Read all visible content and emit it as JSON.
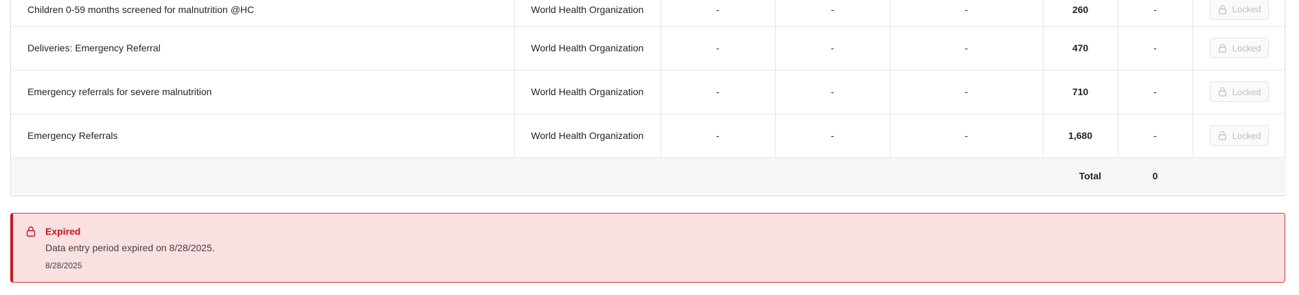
{
  "table": {
    "rows": [
      {
        "name": "Children 0-59 months screened for malnutrition @HC",
        "organization": "World Health Organization",
        "v1": "-",
        "v2": "-",
        "v3": "-",
        "v4": "260",
        "v5": "-",
        "action": "Locked"
      },
      {
        "name": "Deliveries: Emergency Referral",
        "organization": "World Health Organization",
        "v1": "-",
        "v2": "-",
        "v3": "-",
        "v4": "470",
        "v5": "-",
        "action": "Locked"
      },
      {
        "name": "Emergency referrals for severe malnutrition",
        "organization": "World Health Organization",
        "v1": "-",
        "v2": "-",
        "v3": "-",
        "v4": "710",
        "v5": "-",
        "action": "Locked"
      },
      {
        "name": "Emergency Referrals",
        "organization": "World Health Organization",
        "v1": "-",
        "v2": "-",
        "v3": "-",
        "v4": "1,680",
        "v5": "-",
        "action": "Locked"
      }
    ],
    "total": {
      "label": "Total",
      "value": "0"
    }
  },
  "alert": {
    "title": "Expired",
    "message": "Data entry period expired on 8/28/2025.",
    "date": "8/28/2025",
    "icon": "lock-icon",
    "accent_color": "#c4171f",
    "background_color": "#f9e0e1"
  }
}
